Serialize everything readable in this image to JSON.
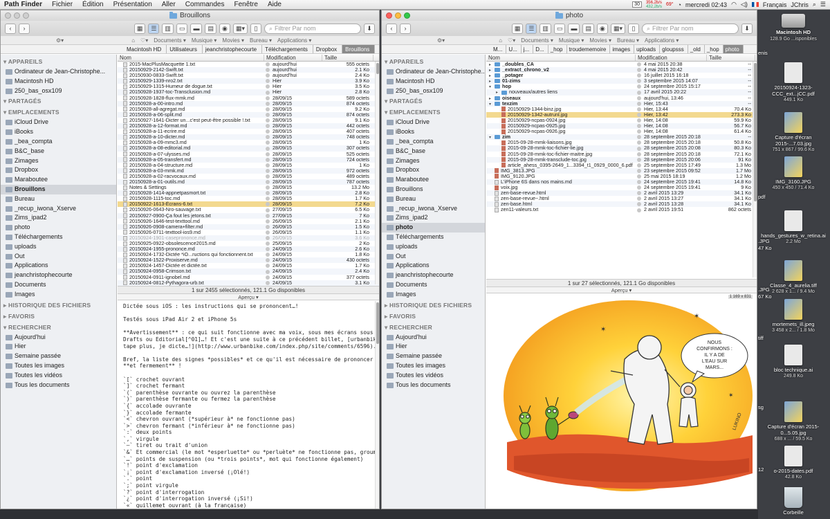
{
  "menubar": {
    "app": "Path Finder",
    "items": [
      "Fichier",
      "Édition",
      "Présentation",
      "Aller",
      "Commandes",
      "Fenêtre",
      "Aide"
    ],
    "net_up": "356,2b/s",
    "net_down": "432,2b/s",
    "cal_day": "30",
    "temp": "69°",
    "clock": "mercredi 02:43",
    "lang": "Français",
    "user": "JChris"
  },
  "left": {
    "title": "Brouillons",
    "search_placeholder": "Filtrer Par nom",
    "favorites": [
      "Documents ▾",
      "Musique ▾",
      "Movies ▾",
      "Bureau ▾",
      "Applications ▾"
    ],
    "path": [
      "Macintosh HD",
      "Utilisateurs",
      "jeanchristophecourte",
      "Téléchargements",
      "Dropbox",
      "Brouillons"
    ],
    "sidebar": [
      {
        "type": "sec",
        "label": "APPAREILS"
      },
      {
        "type": "item",
        "label": "Ordinateur de Jean-Christophe..."
      },
      {
        "type": "item",
        "label": "Macintosh HD"
      },
      {
        "type": "item",
        "label": "250_bas_osx109"
      },
      {
        "type": "sec",
        "label": "PARTAGÉS"
      },
      {
        "type": "sec",
        "label": "EMPLACEMENTS"
      },
      {
        "type": "item",
        "label": "iCloud Drive"
      },
      {
        "type": "item",
        "label": "iBooks"
      },
      {
        "type": "item",
        "label": "_bea_compta"
      },
      {
        "type": "item",
        "label": "B&C_base"
      },
      {
        "type": "item",
        "label": "Zimages"
      },
      {
        "type": "item",
        "label": "Dropbox"
      },
      {
        "type": "item",
        "label": "Maraboutee"
      },
      {
        "type": "item",
        "label": "Brouillons",
        "sel": true
      },
      {
        "type": "item",
        "label": "Bureau"
      },
      {
        "type": "item",
        "label": "_recup_iwona_Xserve"
      },
      {
        "type": "item",
        "label": "Zims_ipad2"
      },
      {
        "type": "item",
        "label": "photo"
      },
      {
        "type": "item",
        "label": "Téléchargements"
      },
      {
        "type": "item",
        "label": "uploads"
      },
      {
        "type": "item",
        "label": "Out"
      },
      {
        "type": "item",
        "label": "Applications"
      },
      {
        "type": "item",
        "label": "jeanchristophecourte"
      },
      {
        "type": "item",
        "label": "Documents"
      },
      {
        "type": "item",
        "label": "Images"
      },
      {
        "type": "sec",
        "label": "HISTORIQUE DES FICHIERS",
        "closed": true
      },
      {
        "type": "sec",
        "label": "FAVORIS",
        "closed": true
      },
      {
        "type": "sec",
        "label": "RECHERCHER"
      },
      {
        "type": "item",
        "label": "Aujourd'hui"
      },
      {
        "type": "item",
        "label": "Hier"
      },
      {
        "type": "item",
        "label": "Semaine passée"
      },
      {
        "type": "item",
        "label": "Toutes les images"
      },
      {
        "type": "item",
        "label": "Toutes les vidéos"
      },
      {
        "type": "item",
        "label": "Tous les documents"
      }
    ],
    "columns": {
      "name": "Nom",
      "mod": "Modification",
      "size": "Taille"
    },
    "rows": [
      [
        "2015-MacPlusMacquette 1.txt",
        "aujourd'hui",
        "555 octets",
        ""
      ],
      [
        "20150929-2142-Swift.txt",
        "aujourd'hui",
        "2.1 Ko",
        ""
      ],
      [
        "20150930-0833-Swift.txt",
        "aujourd'hui",
        "2.4 Ko",
        ""
      ],
      [
        "20150929-1339-nro2.txt",
        "Hier",
        "3.9 Ko",
        ""
      ],
      [
        "20150929-1315-Humeur de dogue.txt",
        "Hier",
        "3.5 Ko",
        ""
      ],
      [
        "20150928-1937-toc-Transclusion.md",
        "Hier",
        "2.8 Ko",
        ""
      ],
      [
        "20150928-1828-flux-mmk.md",
        "28/09/15",
        "589 octets",
        ""
      ],
      [
        "20150928-a-00-intro.md",
        "28/09/15",
        "874 octets",
        ""
      ],
      [
        "20150928-all-agregat.md",
        "28/09/15",
        "9.2 Ko",
        ""
      ],
      [
        "20150928-a-06-split.md",
        "28/09/15",
        "874 octets",
        ""
      ],
      [
        "20150927-1641-Dicter un...c'est peut-être possible !.txt",
        "28/09/15",
        "9.1 Ko",
        ""
      ],
      [
        "20150928-a-12-format.md",
        "28/09/15",
        "442 octets",
        ""
      ],
      [
        "20150928-a-11-ecrire.md",
        "28/09/15",
        "407 octets",
        ""
      ],
      [
        "20150928-a-10-dicter.md",
        "28/09/15",
        "748 octets",
        ""
      ],
      [
        "20150928-a-09-mmc3.md",
        "28/09/15",
        "1 Ko",
        ""
      ],
      [
        "20150928-a-08-editorial.md",
        "28/09/15",
        "307 octets",
        ""
      ],
      [
        "20150928-a-07-ulysses.md",
        "28/09/15",
        "525 octets",
        ""
      ],
      [
        "20150928-a-05-transfert.md",
        "28/09/15",
        "724 octets",
        ""
      ],
      [
        "20150928-a-04-structure.md",
        "28/09/15",
        "1 Ko",
        ""
      ],
      [
        "20150928-a-03-mmk.md",
        "28/09/15",
        "972 octets",
        ""
      ],
      [
        "20150928-a-02-racvocaux.md",
        "28/09/15",
        "489 octets",
        ""
      ],
      [
        "20150928-a-01-outils.md",
        "28/09/15",
        "787 octets",
        ""
      ],
      [
        "Notes & Settings",
        "28/09/15",
        "13.2 Mo",
        ""
      ],
      [
        "20150928-1414-appnetpasmort.txt",
        "28/09/15",
        "2.8 Ko",
        ""
      ],
      [
        "20150928-1115-toc.md",
        "28/09/15",
        "1.7 Ko",
        ""
      ],
      [
        "20150922-1613-Écrans-6.txt",
        "28/09/15",
        "7.2 Ko",
        "hl"
      ],
      [
        "20150926-0643-Nro-sauvage.txt",
        "27/09/15",
        "6.5 Ko",
        ""
      ],
      [
        "20150927-0900-Ça fout les jetons.txt",
        "27/09/15",
        "7 Ko",
        ""
      ],
      [
        "20150926-1646-test-texttool.md",
        "26/09/15",
        "2.1 Ko",
        ""
      ],
      [
        "20150926-0908-camera+filter.md",
        "26/09/15",
        "1.5 Ko",
        ""
      ],
      [
        "20150926-0711-texttool-ios9.md",
        "26/09/15",
        "1.1 Ko",
        ""
      ],
      [
        "20150924-1901-caseprononce.md",
        "26/09/15",
        "3.6 Ko",
        "gr"
      ],
      [
        "20150925-0922-obsolescence2015.md",
        "25/09/15",
        "2 Ko",
        ""
      ],
      [
        "20150924-1955-prononce.md",
        "24/09/15",
        "2.6 Ko",
        ""
      ],
      [
        "20150924-1732-Dictée *iO...ructions qui fonctionnent.txt",
        "24/09/15",
        "1.8 Ko",
        ""
      ],
      [
        "20150924-1522-Proxiserve.md",
        "24/09/15",
        "430 octets",
        ""
      ],
      [
        "20150924-1457-Dictée et dictée.txt",
        "24/09/15",
        "1.7 Ko",
        ""
      ],
      [
        "20150924-0958-Crimson.txt",
        "24/09/15",
        "2.4 Ko",
        ""
      ],
      [
        "20150924-0911-ignobel.md",
        "24/09/15",
        "377 octets",
        ""
      ],
      [
        "20150924-0812-Pythagora-urb.txt",
        "24/09/15",
        "3.1 Ko",
        ""
      ]
    ],
    "status": "1 sur 2455 sélectionnés, 121.1 Go disponibles",
    "apercu": "Aperçu ▾",
    "preview": "Dictée sous iOS : les instructions qui se prononcent…!\n\nTestés sous iPad Air 2 et iPhone 5s\n\n**Avertissement** : ce qui suit fonctionne avec ma voix, sous mes écrans sous *iOS* 9 et\nDrafts ou Editorial[^01]…! Et c'est une suite à ce précédent billet, [urbanbike | Je ne\ntape plus, je dicte…!](http://www.urbanbike.com/index.php/site/comments/6596).\n\nBref, la liste des signes *possibles* et ce qu'il est nécessaire de prononcer rapidement\n**et fermement** !\n\n`[` crochet ouvrant\n`]` crochet fermant\n`(` parenthèse ouvrante ou ouvrez la parenthèse\n`)` parenthèse fermante ou fermez la parenthèse\n`{` accolade ouvrante\n`}` accolade fermante\n`<` chevron ouvrant (*supérieur à* ne fonctionne pas)\n`>` chevron fermant (*inférieur à* ne fonctionne pas)\n`:` deux points\n`,` virgule\n`—` tiret ou trait d'union\n`&` Et commercial (le mot *esperluette* ou *perluète* ne fonctionne pas, groumph…)\n`…` points de suspension (ou *trois points*, mot qui fonctionne également)\n`!` point d'exclamation\n`¡` point d'exclamation inversé (¡Olé!)\n`.` point\n`;` point virgule\n`?` point d'interrogation\n`¿` point d'interrogation inversé (¡Si!)\n`«` guillemet ouvrant (à la française)\n`»` guillemet fermant (à la française)\n`'` guillemet simple ouvrant\n`'` guillemet simple fermant\n`\"` guillemet anglais ouvrant"
  },
  "right": {
    "title": "photo",
    "search_placeholder": "Filtrer Par nom",
    "favorites": [
      "Documents ▾",
      "Musique ▾",
      "Movies ▾",
      "Bureau ▾",
      "Applications ▾"
    ],
    "path": [
      "M...",
      "U...",
      "j...",
      "D...",
      "_hop",
      "troudememoire",
      "images",
      "uploads",
      "gloupsss",
      "_old",
      "_hop",
      "photo"
    ],
    "sidebar": [
      {
        "type": "sec",
        "label": "APPAREILS"
      },
      {
        "type": "item",
        "label": "Ordinateur de Jean-Christophe..."
      },
      {
        "type": "item",
        "label": "Macintosh HD"
      },
      {
        "type": "item",
        "label": "250_bas_osx109"
      },
      {
        "type": "sec",
        "label": "PARTAGÉS"
      },
      {
        "type": "sec",
        "label": "EMPLACEMENTS"
      },
      {
        "type": "item",
        "label": "iCloud Drive"
      },
      {
        "type": "item",
        "label": "iBooks"
      },
      {
        "type": "item",
        "label": "_bea_compta"
      },
      {
        "type": "item",
        "label": "B&C_base"
      },
      {
        "type": "item",
        "label": "Zimages"
      },
      {
        "type": "item",
        "label": "Dropbox"
      },
      {
        "type": "item",
        "label": "Maraboutee"
      },
      {
        "type": "item",
        "label": "Brouillons"
      },
      {
        "type": "item",
        "label": "Bureau"
      },
      {
        "type": "item",
        "label": "_recup_iwona_Xserve"
      },
      {
        "type": "item",
        "label": "Zims_ipad2"
      },
      {
        "type": "item",
        "label": "photo",
        "sel": true
      },
      {
        "type": "item",
        "label": "Téléchargements"
      },
      {
        "type": "item",
        "label": "uploads"
      },
      {
        "type": "item",
        "label": "Out"
      },
      {
        "type": "item",
        "label": "Applications"
      },
      {
        "type": "item",
        "label": "jeanchristophecourte"
      },
      {
        "type": "item",
        "label": "Documents"
      },
      {
        "type": "item",
        "label": "Images"
      },
      {
        "type": "sec",
        "label": "HISTORIQUE DES FICHIERS",
        "closed": true
      },
      {
        "type": "sec",
        "label": "FAVORIS",
        "closed": true
      },
      {
        "type": "sec",
        "label": "RECHERCHER"
      },
      {
        "type": "item",
        "label": "Aujourd'hui"
      },
      {
        "type": "item",
        "label": "Hier"
      },
      {
        "type": "item",
        "label": "Semaine passée"
      },
      {
        "type": "item",
        "label": "Toutes les images"
      },
      {
        "type": "item",
        "label": "Toutes les vidéos"
      },
      {
        "type": "item",
        "label": "Tous les documents"
      }
    ],
    "columns": {
      "name": "Nom",
      "mod": "Modification",
      "size": "Taille"
    },
    "rows": [
      [
        "_doubles_CA",
        "4 mai 2015 20:38",
        "--",
        "fo",
        0,
        "▸"
      ],
      [
        "_extract_chrono_v2",
        "4 mai 2015 20:42",
        "--",
        "fo",
        0,
        "▸"
      ],
      [
        "_potager",
        "16 juillet 2015 16:18",
        "--",
        "fo",
        0,
        "▸"
      ],
      [
        "01-zims",
        "3 septembre 2015 14:07",
        "--",
        "fo",
        0,
        "▸"
      ],
      [
        "hop",
        "24 septembre 2015 15:17",
        "--",
        "fo",
        0,
        "▾"
      ],
      [
        "nouveaux/autres liens",
        "17 avril 2015 20:22",
        "--",
        "fo",
        1,
        "▸"
      ],
      [
        "oiseaux",
        "aujourd'hui, 13:46",
        "--",
        "fo",
        0,
        "▸"
      ],
      [
        "texzim",
        "Hier, 15:43",
        "--",
        "fo",
        0,
        "▾"
      ],
      [
        "20150929-1344-binz.jpg",
        "Hier, 13:44",
        "70.4 Ko",
        "ji",
        1,
        ""
      ],
      [
        "20150929-1342-autrunl.jpg",
        "Hier, 13:42",
        "273.3 Ko",
        "ji",
        1,
        "",
        "hl"
      ],
      [
        "20150929-ncpas-0924.jpg",
        "Hier, 14:08",
        "59.9 Ko",
        "ji",
        1,
        ""
      ],
      [
        "20150929-ncpas-0925.jpg",
        "Hier, 14:08",
        "56.7 Ko",
        "ji",
        1,
        ""
      ],
      [
        "20150929-ncpas-0926.jpg",
        "Hier, 14:08",
        "61.4 Ko",
        "ji",
        1,
        ""
      ],
      [
        "zim",
        "28 septembre 2015 20:18",
        "--",
        "fo",
        0,
        "▾"
      ],
      [
        "2015-09-28-mmk-liaisons.jpg",
        "28 septembre 2015 20:18",
        "50.8 Ko",
        "ji",
        1,
        ""
      ],
      [
        "2015-09-28-mmk-toc-fichier-lie.jpg",
        "28 septembre 2015 20:08",
        "80.3 Ko",
        "ji",
        1,
        ""
      ],
      [
        "2015-09-28-mmk-toc-fichier-maitre.jpg",
        "28 septembre 2015 20:18",
        "72.1 Ko",
        "ji",
        1,
        ""
      ],
      [
        "2015-09-28-mmk-transclude-toc.jpg",
        "28 septembre 2015 20:06",
        "91 Ko",
        "ji",
        1,
        ""
      ],
      [
        "article_ahess_0395-2649_1...3394_t1_0929_0000_6.pdf",
        "25 septembre 2015 17:49",
        "1.3 Mo",
        "ji",
        1,
        ""
      ],
      [
        "IMG_3813.JPG",
        "23 septembre 2015 09:52",
        "1.7 Mo",
        "ji",
        0,
        ""
      ],
      [
        "IMG_9120.JPG",
        "25 mai 2015 18:19",
        "1.2 Mo",
        "ji",
        0,
        ""
      ],
      [
        "L'iPhone 6S dans nos mains.md",
        "24 septembre 2015 19:41",
        "14.8 Ko",
        "fi",
        0,
        ""
      ],
      [
        "voix.jpg",
        "24 septembre 2015 19:41",
        "9 Ko",
        "ji",
        0,
        ""
      ],
      [
        "zen-base-revue.html",
        "2 avril 2015 13:29",
        "34.1 Ko",
        "fi",
        0,
        ""
      ],
      [
        "zen-base-revue~.html",
        "2 avril 2015 13:27",
        "34.1 Ko",
        "fi",
        0,
        ""
      ],
      [
        "zen-base.html",
        "2 avril 2015 13:28",
        "34.1 Ko",
        "fi",
        0,
        ""
      ],
      [
        "zen11-valeurs.txt",
        "2 avril 2015 19:51",
        "862 octets",
        "fi",
        0,
        ""
      ]
    ],
    "status": "1 sur 27 sélectionnés, 121.1 Go disponibles",
    "apercu": "Aperçu ▾",
    "img_badge": "1 169 x 831",
    "bubble": [
      "NOUS",
      "CONFIRMONS :",
      "IL Y A DE",
      "L'EAU SUR",
      "MARS..."
    ],
    "signature": "LUKINO"
  },
  "desktop": {
    "hd_name": "Macintosh HD",
    "hd_sub": "128.9 Go ...isponibles",
    "items": [
      {
        "name": "20150924-1323-CCC_ext...jCC.pdf",
        "sub": "449.1 Ko",
        "kind": "doc"
      },
      {
        "name": "Capture d'écran 2015-...7.03.jpg",
        "sub": "751 x 867 / 99.6 Ko",
        "kind": "img"
      },
      {
        "name": "IMG_3160.JPG",
        "sub": "450 x 450 / 71.4 Ko",
        "kind": "img"
      },
      {
        "name": "hands_gestures_w_retina.ai",
        "sub": "2.2 Mo",
        "kind": "doc"
      },
      {
        "name": "Classe_4_aurelia.tiff",
        "sub": "2 628 x 1... / 9.4 Mo",
        "kind": "img"
      },
      {
        "name": "mortemets_ill.jpeg",
        "sub": "3 458 x 2... / 1.8 Mo",
        "kind": "img"
      },
      {
        "name": "bloc technique.ai",
        "sub": "249.8 Ko",
        "kind": "doc"
      },
      {
        "name": "Capture d'écran 2015-0...5.05.jpg",
        "sub": "688 x ... / 59.5 Ko",
        "kind": "img"
      },
      {
        "name": "o-2015-dates.pdf",
        "sub": "42.8 Ko",
        "kind": "doc"
      }
    ],
    "fragments": [
      "enis",
      "pdf",
      ".JPG",
      "47 Ko",
      ".JPG",
      "67 Ko",
      "tiff",
      "sg",
      "12"
    ],
    "trash": "Corbeille"
  }
}
